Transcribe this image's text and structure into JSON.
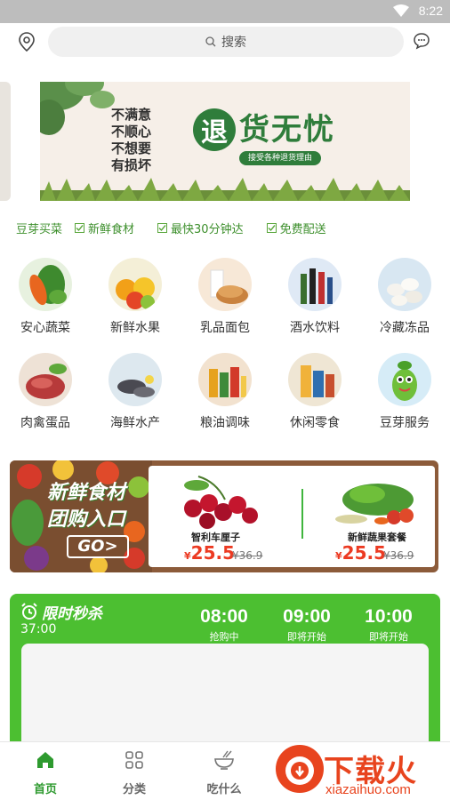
{
  "status_bar": {
    "time": "8:22"
  },
  "header": {
    "search_label": "搜索"
  },
  "banner": {
    "lines": [
      "不满意",
      "不顺心",
      "不想要",
      "有损坏"
    ],
    "circle_char": "退",
    "title": "货无忧",
    "tag": "接受各种退货理由"
  },
  "features": {
    "brand": "豆芽买菜",
    "items": [
      "新鲜食材",
      "最快30分钟达",
      "免费配送"
    ]
  },
  "categories": [
    {
      "label": "安心蔬菜",
      "icon": "vegetables-icon"
    },
    {
      "label": "新鲜水果",
      "icon": "fruits-icon"
    },
    {
      "label": "乳品面包",
      "icon": "dairy-bread-icon"
    },
    {
      "label": "酒水饮料",
      "icon": "drinks-icon"
    },
    {
      "label": "冷藏冻品",
      "icon": "frozen-food-icon"
    },
    {
      "label": "肉禽蛋品",
      "icon": "meat-icon"
    },
    {
      "label": "海鲜水产",
      "icon": "seafood-icon"
    },
    {
      "label": "粮油调味",
      "icon": "grain-oil-icon"
    },
    {
      "label": "休闲零食",
      "icon": "snacks-icon"
    },
    {
      "label": "豆芽服务",
      "icon": "service-mascot-icon"
    }
  ],
  "promo": {
    "line1": "新鲜食材",
    "line2": "团购入口",
    "go": "GO>",
    "products": [
      {
        "name": "智利车厘子",
        "currency": "¥",
        "price": "25.5",
        "old_price": "¥36.9"
      },
      {
        "name": "新鲜蔬果套餐",
        "currency": "¥",
        "price": "25.5",
        "old_price": "¥36.9"
      }
    ]
  },
  "flash_sale": {
    "title": "限时秒杀",
    "countdown": "37:00",
    "slots": [
      {
        "time": "08:00",
        "status": "抢购中"
      },
      {
        "time": "09:00",
        "status": "即将开始"
      },
      {
        "time": "10:00",
        "status": "即将开始"
      }
    ]
  },
  "bottom_nav": [
    {
      "label": "首页",
      "active": true
    },
    {
      "label": "分类",
      "active": false
    },
    {
      "label": "吃什么",
      "active": false
    }
  ],
  "watermark": {
    "brand": "下载火",
    "url": "xiazaihuo.com"
  },
  "colors": {
    "brand_green": "#4cbf31",
    "price_red": "#ec3a22",
    "dark_green": "#2f7d3b"
  }
}
